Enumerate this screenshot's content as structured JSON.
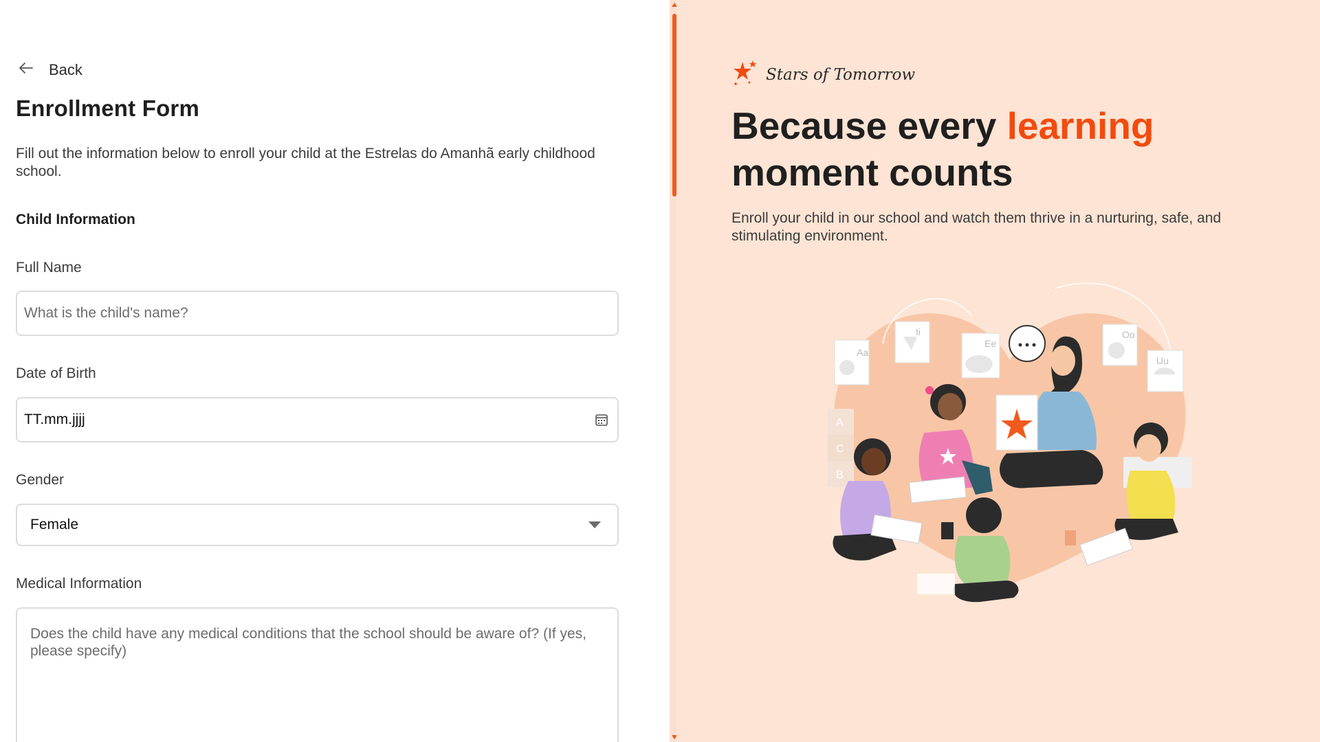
{
  "form": {
    "back_label": "Back",
    "title": "Enrollment Form",
    "intro": "Fill out the information below to enroll your child at the Estrelas do Amanhã early childhood school.",
    "section_title": "Child Information",
    "full_name": {
      "label": "Full Name",
      "placeholder": "What is the child's name?"
    },
    "dob": {
      "label": "Date of Birth",
      "value": "TT.mm.jjjj"
    },
    "gender": {
      "label": "Gender",
      "selected": "Female"
    },
    "medical": {
      "label": "Medical Information",
      "placeholder": "Does the child have any medical conditions that the school should be aware of? (If yes, please specify)"
    }
  },
  "hero": {
    "brand": "Stars of Tomorrow",
    "headline_part1": "Because every ",
    "headline_accent": "learning",
    "headline_part2": " moment counts",
    "subtext": "Enroll your child in our school and watch them thrive in a nurturing, safe, and stimulating environment.",
    "illustration_letters": [
      "Aa",
      "Ii",
      "Ee",
      "Oo",
      "Uu",
      "A",
      "C",
      "B"
    ]
  },
  "colors": {
    "accent": "#f24b0f",
    "panel_bg": "#fde4d4",
    "border": "#dcdcdc"
  },
  "icons": [
    "arrow-left-icon",
    "calendar-icon",
    "chevron-down-icon",
    "star-logo-icon"
  ]
}
